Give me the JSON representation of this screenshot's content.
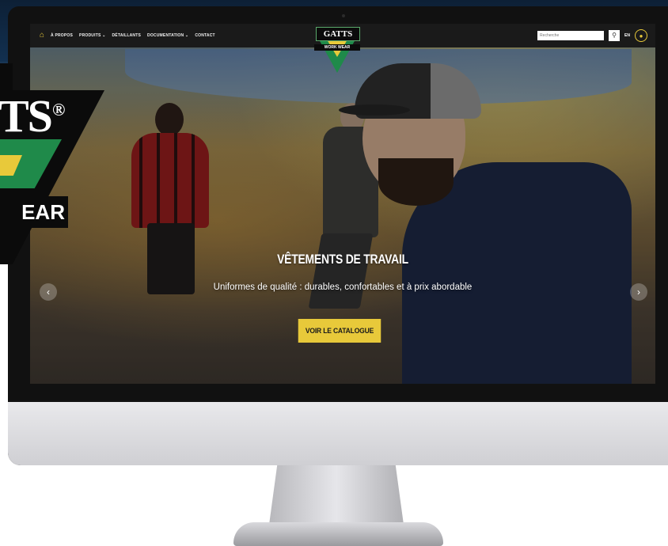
{
  "nav": {
    "items": [
      "À PROPOS",
      "PRODUITS ⌄",
      "DÉTAILLANTS",
      "DOCUMENTATION ⌄",
      "CONTACT"
    ],
    "search_placeholder": "Recherche",
    "lang": "EN",
    "logo_top": "GATTS",
    "logo_sub": "WORK WEAR"
  },
  "hero": {
    "title": "VÊTEMENTS DE TRAVAIL",
    "subtitle": "Uniformes de qualité : durables, confortables et à prix abordable",
    "cta_label": "VOIR LE CATALOGUE"
  },
  "brand": {
    "text": "TS",
    "reg": "®",
    "sub": "EAR"
  },
  "colors": {
    "accent_yellow": "#e8c93a",
    "brand_green": "#1f8a4a",
    "nav_bg": "#1a1a1a"
  },
  "icons": {
    "home": "home-icon",
    "search": "search-icon",
    "account": "account-icon",
    "arrow_left": "chevron-left-icon",
    "arrow_right": "chevron-right-icon"
  }
}
